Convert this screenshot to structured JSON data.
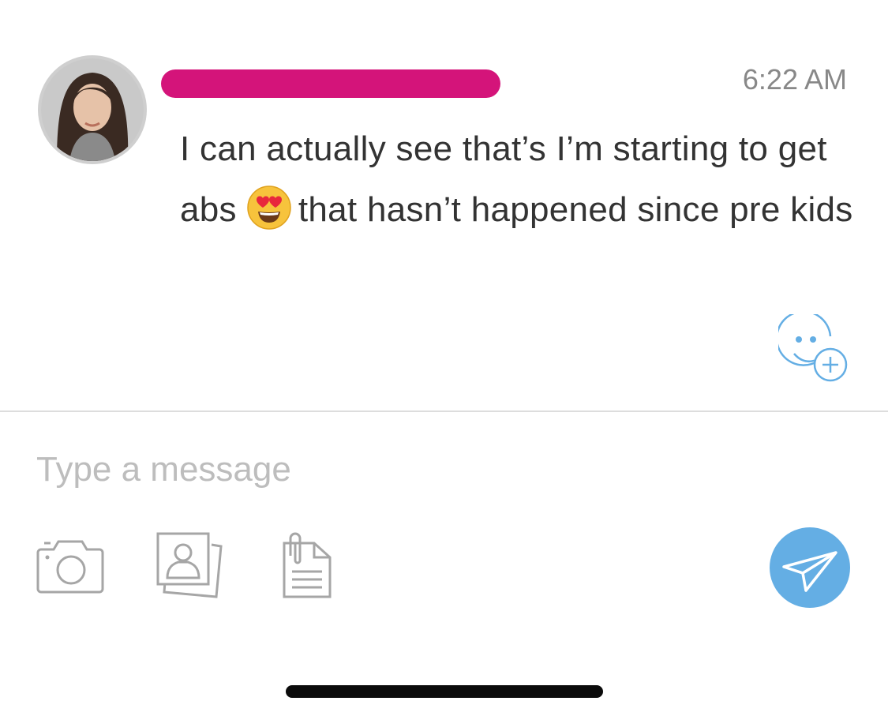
{
  "message": {
    "sender_name": "",
    "timestamp": "6:22 AM",
    "text_part1": "I can actually see that’s I’m starting to get abs",
    "emoji": "smiling-face-with-heart-eyes",
    "text_part2": "that hasn’t happened since pre kids"
  },
  "reaction_button_icon": "add-reaction-icon",
  "composer": {
    "placeholder": "Type a message",
    "value": ""
  },
  "toolbar": {
    "camera_icon": "camera-icon",
    "photo_icon": "photo-library-icon",
    "file_icon": "file-attachment-icon",
    "send_icon": "send-icon"
  },
  "colors": {
    "redaction": "#d4147a",
    "accent": "#64aee4",
    "text": "#333333",
    "placeholder": "#bdbdbd"
  }
}
